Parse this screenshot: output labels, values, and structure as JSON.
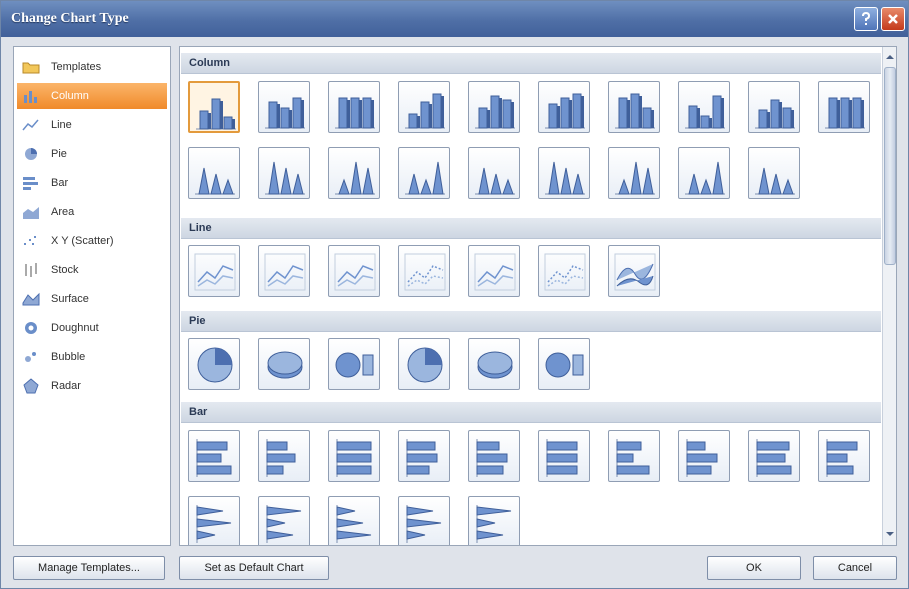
{
  "window": {
    "title": "Change Chart Type"
  },
  "categories": [
    {
      "label": "Templates",
      "icon": "folder-icon"
    },
    {
      "label": "Column",
      "icon": "column-chart-icon",
      "selected": true
    },
    {
      "label": "Line",
      "icon": "line-chart-icon"
    },
    {
      "label": "Pie",
      "icon": "pie-chart-icon"
    },
    {
      "label": "Bar",
      "icon": "bar-chart-icon"
    },
    {
      "label": "Area",
      "icon": "area-chart-icon"
    },
    {
      "label": "X Y (Scatter)",
      "icon": "scatter-chart-icon"
    },
    {
      "label": "Stock",
      "icon": "stock-chart-icon"
    },
    {
      "label": "Surface",
      "icon": "surface-chart-icon"
    },
    {
      "label": "Doughnut",
      "icon": "doughnut-chart-icon"
    },
    {
      "label": "Bubble",
      "icon": "bubble-chart-icon"
    },
    {
      "label": "Radar",
      "icon": "radar-chart-icon"
    }
  ],
  "sections": {
    "column": {
      "heading": "Column",
      "count": 19
    },
    "line": {
      "heading": "Line",
      "count": 7
    },
    "pie": {
      "heading": "Pie",
      "count": 6
    },
    "bar": {
      "heading": "Bar",
      "count": 15
    }
  },
  "buttons": {
    "manage_templates": "Manage Templates...",
    "set_default": "Set as Default Chart",
    "ok": "OK",
    "cancel": "Cancel"
  },
  "colors": {
    "accent": "#f08a2a",
    "title_bar": "#4f6fa6"
  }
}
